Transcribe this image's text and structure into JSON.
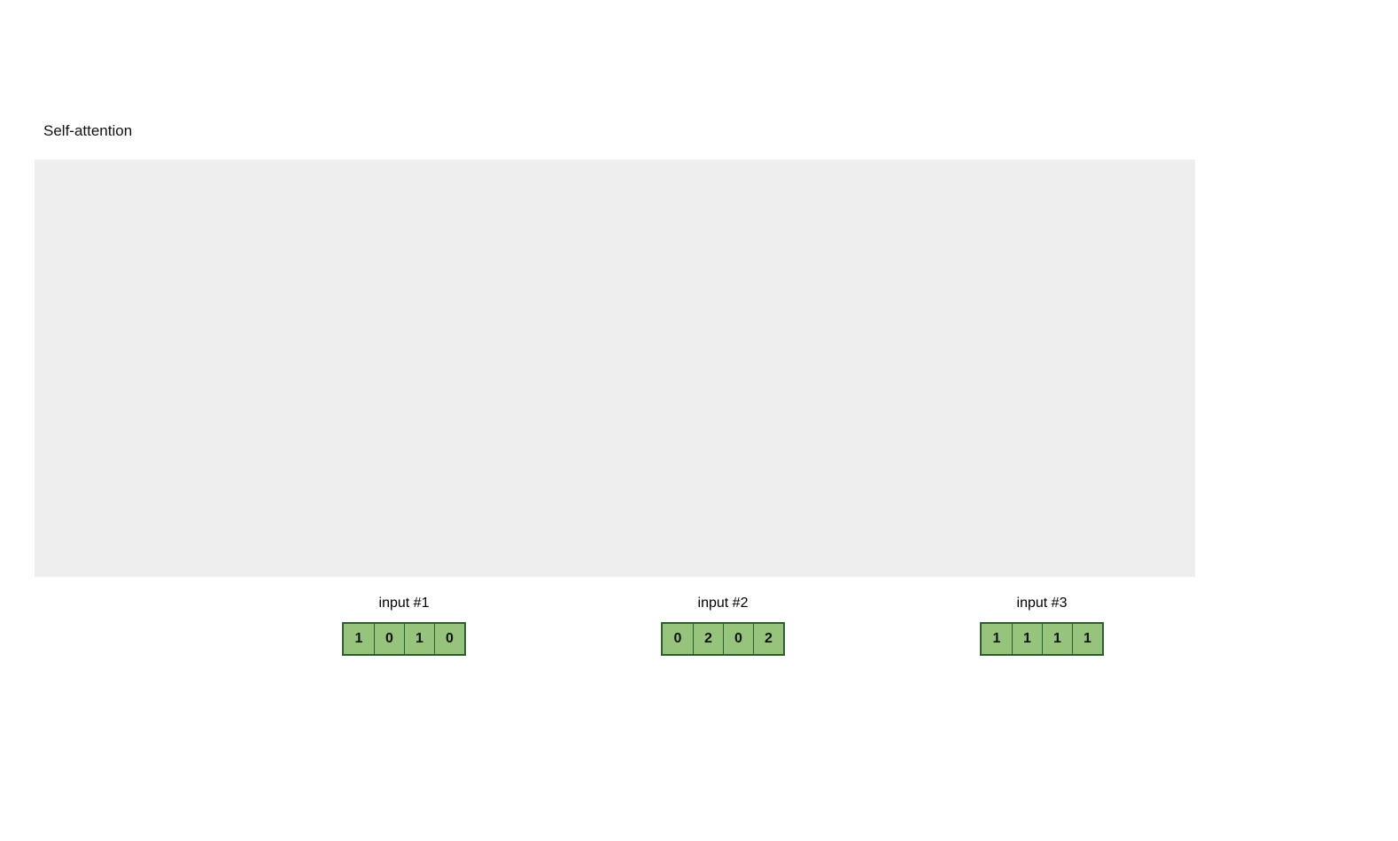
{
  "title": "Self-attention",
  "inputs": [
    {
      "label": "input #1",
      "values": [
        "1",
        "0",
        "1",
        "0"
      ]
    },
    {
      "label": "input #2",
      "values": [
        "0",
        "2",
        "0",
        "2"
      ]
    },
    {
      "label": "input #3",
      "values": [
        "1",
        "1",
        "1",
        "1"
      ]
    }
  ],
  "colors": {
    "cell_bg": "#97c47d",
    "cell_border": "#2a5e2a",
    "canvas_bg": "#eeeeee"
  }
}
